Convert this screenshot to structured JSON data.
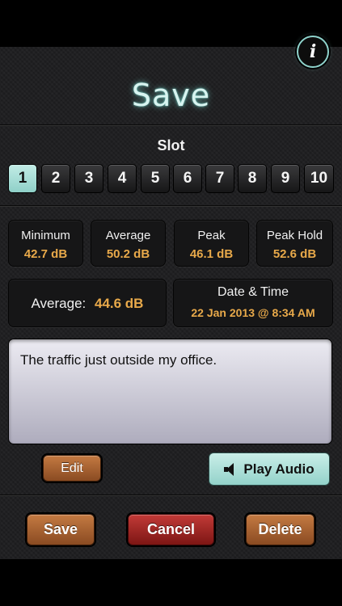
{
  "header": {
    "title": "Save",
    "info_icon": "info-icon"
  },
  "slot": {
    "label": "Slot",
    "selected": 1,
    "buttons": [
      "1",
      "2",
      "3",
      "4",
      "5",
      "6",
      "7",
      "8",
      "9",
      "10"
    ]
  },
  "stats": {
    "minimum": {
      "label": "Minimum",
      "value": "42.7 dB"
    },
    "average": {
      "label": "Average",
      "value": "50.2 dB"
    },
    "peak": {
      "label": "Peak",
      "value": "46.1 dB"
    },
    "peak_hold": {
      "label": "Peak Hold",
      "value": "52.6 dB"
    }
  },
  "summary": {
    "average_label": "Average:",
    "average_value": "44.6 dB",
    "datetime_label": "Date & Time",
    "datetime_value": "22 Jan 2013 @ 8:34 AM"
  },
  "note": {
    "text": "The traffic just outside my office."
  },
  "actions": {
    "edit_label": "Edit",
    "play_label": "Play Audio",
    "save_label": "Save",
    "cancel_label": "Cancel",
    "delete_label": "Delete"
  },
  "colors": {
    "accent_teal": "#8fd3cc",
    "value_orange": "#e8a94a",
    "copper": "#b06a36",
    "cancel_red": "#a82522"
  }
}
